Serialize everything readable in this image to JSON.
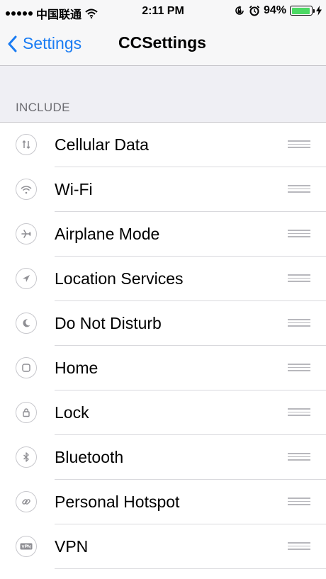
{
  "status_bar": {
    "carrier": "中国联通",
    "time": "2:11 PM",
    "battery_percent": "94%",
    "battery_level": 0.94,
    "icons": [
      "signal-dots-icon",
      "wifi-icon",
      "rotation-lock-icon",
      "alarm-icon",
      "battery-icon",
      "charging-bolt-icon"
    ]
  },
  "nav": {
    "back_label": "Settings",
    "title": "CCSettings"
  },
  "section": {
    "header": "INCLUDE"
  },
  "items": [
    {
      "label": "Cellular Data",
      "icon": "cellular-data-icon"
    },
    {
      "label": "Wi-Fi",
      "icon": "wifi-icon"
    },
    {
      "label": "Airplane Mode",
      "icon": "airplane-icon"
    },
    {
      "label": "Location Services",
      "icon": "location-icon"
    },
    {
      "label": "Do Not Disturb",
      "icon": "moon-icon"
    },
    {
      "label": "Home",
      "icon": "home-icon"
    },
    {
      "label": "Lock",
      "icon": "lock-icon"
    },
    {
      "label": "Bluetooth",
      "icon": "bluetooth-icon"
    },
    {
      "label": "Personal Hotspot",
      "icon": "link-icon"
    },
    {
      "label": "VPN",
      "icon": "vpn-icon"
    }
  ],
  "colors": {
    "accent": "#1a7cf3",
    "battery": "#4cd964",
    "background": "#efeff4"
  }
}
